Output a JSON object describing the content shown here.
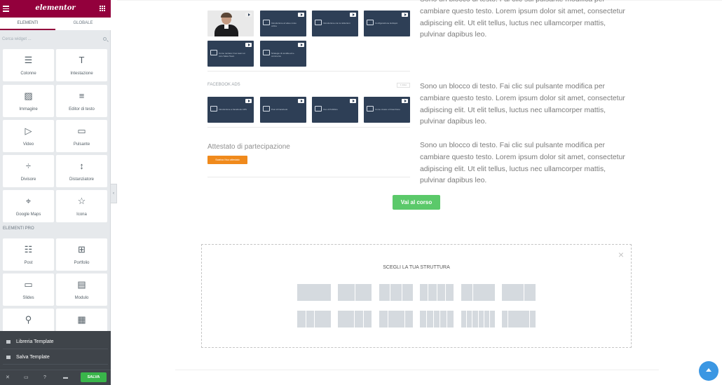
{
  "sidebar": {
    "logo": "elementor",
    "tabs": [
      {
        "label": "ELEMENTI"
      },
      {
        "label": "GLOBALE"
      }
    ],
    "search_placeholder": "Cerca widget ...",
    "widgets_basic": [
      {
        "label": "Colonne",
        "icon": "columns-icon"
      },
      {
        "label": "Intestazione",
        "icon": "heading-icon"
      },
      {
        "label": "Immagine",
        "icon": "image-icon"
      },
      {
        "label": "Editor di testo",
        "icon": "text-editor-icon"
      },
      {
        "label": "Video",
        "icon": "video-icon"
      },
      {
        "label": "Pulsante",
        "icon": "button-icon"
      },
      {
        "label": "Divisore",
        "icon": "divider-icon"
      },
      {
        "label": "Distanziatore",
        "icon": "spacer-icon"
      },
      {
        "label": "Google Maps",
        "icon": "map-icon"
      },
      {
        "label": "Icona",
        "icon": "star-icon"
      }
    ],
    "pro_label": "ELEMENTI PRO",
    "widgets_pro": [
      {
        "label": "Post",
        "icon": "posts-icon"
      },
      {
        "label": "Portfolio",
        "icon": "portfolio-icon"
      },
      {
        "label": "Slides",
        "icon": "slides-icon"
      },
      {
        "label": "Modulo",
        "icon": "form-icon"
      },
      {
        "label": "",
        "icon": "login-icon"
      },
      {
        "label": "",
        "icon": "nav-menu-icon"
      }
    ],
    "bottom_menu": [
      {
        "label": "Libreria Template",
        "icon": "folder-icon"
      },
      {
        "label": "Salva Template",
        "icon": "save-icon"
      }
    ],
    "footer": {
      "save_label": "SALVA"
    }
  },
  "content": {
    "paragraph": "Sono un blocco di testo. Fai clic sul pulsante modifica per cambiare questo testo. Lorem ipsum dolor sit amet, consectetur adipiscing elit. Ut elit tellus, luctus nec ullamcorper mattis, pulvinar dapibus leo.",
    "paragraph_top": "Sono un blocco di testo. Fai clic sul pulsante modifica per cambiare questo testo. Lorem ipsum dolor sit amet, consectetur adipiscing elit. Ut elit tellus, luctus nec ullamcorper mattis, pulvinar dapibus leo.",
    "video_row1": [
      {
        "caption": "",
        "type": "photo"
      },
      {
        "caption": "Introduzione al video corso online"
      },
      {
        "caption": "Introduzione con le istituzioni"
      },
      {
        "caption": "Configurazione Hubspot"
      }
    ],
    "video_row2": [
      {
        "caption": "Come rendere il tuo team un vero Sales Team"
      },
      {
        "caption": "Strategie di vendita ed e-commerce"
      }
    ],
    "facebook_heading": "FACEBOOK ADS",
    "facebook_badge": "1 video",
    "video_row3": [
      {
        "caption": "Introduzione a Facebook ADS"
      },
      {
        "caption": "Post di Facebook"
      },
      {
        "caption": "Uso di Pubblico"
      },
      {
        "caption": "Come creare un'inserzione"
      }
    ],
    "attestato_title": "Attestato di partecipazione",
    "attestato_button": "Scarica il tuo attestato",
    "cta_button": "Vai al corso",
    "structure_title": "SCEGLI LA TUA STRUTTURA"
  },
  "colors": {
    "brand": "#93003c",
    "save_green": "#39b54a",
    "cta_green": "#5bc96a",
    "orange": "#f08a1c",
    "scroll_blue": "#3b97e3"
  }
}
